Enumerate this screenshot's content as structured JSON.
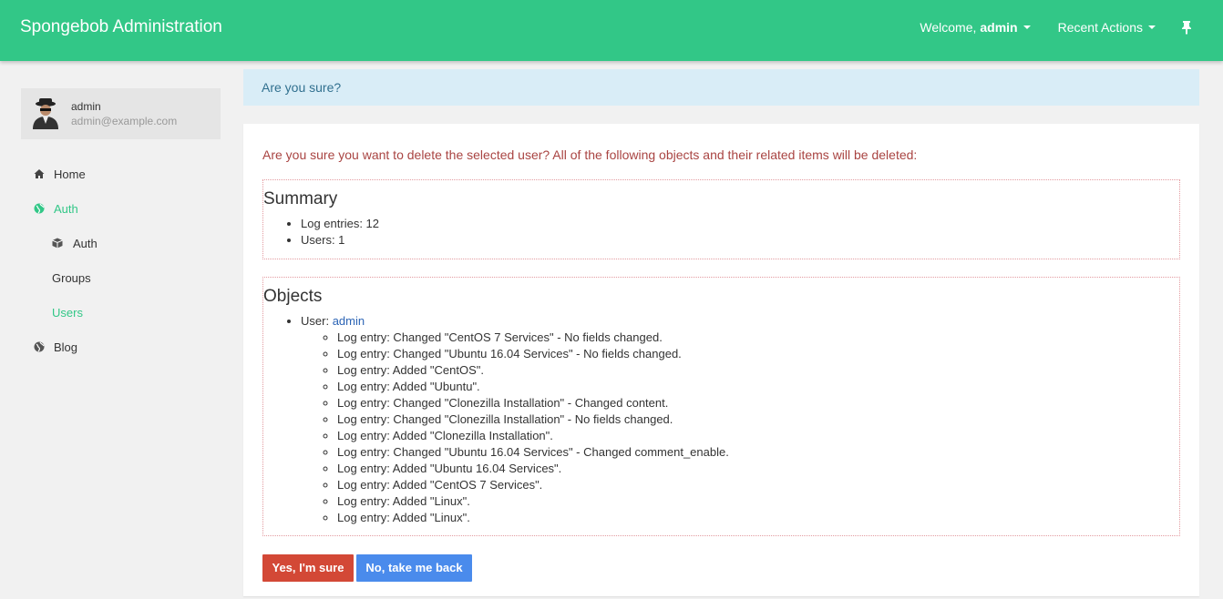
{
  "navbar": {
    "brand": "Spongebob Administration",
    "welcome_prefix": "Welcome,",
    "welcome_user": "admin",
    "recent_actions": "Recent Actions",
    "color": "#32c787"
  },
  "profile": {
    "name": "admin",
    "email": "admin@example.com"
  },
  "sidebar": {
    "items": [
      {
        "label": "Home",
        "icon": "home-icon"
      },
      {
        "label": "Auth",
        "icon": "globe-icon"
      },
      {
        "label": "Auth",
        "icon": "cube-icon"
      },
      {
        "label": "Groups"
      },
      {
        "label": "Users"
      },
      {
        "label": "Blog",
        "icon": "globe-icon"
      }
    ]
  },
  "alert": "Are you sure?",
  "question": "Are you sure you want to delete the selected user? All of the following objects and their related items will be deleted:",
  "summary": {
    "title": "Summary",
    "items": [
      "Log entries: 12",
      "Users: 1"
    ]
  },
  "objects": {
    "title": "Objects",
    "user_prefix": "User:",
    "user_link": "admin",
    "entries": [
      "Log entry: Changed \"CentOS 7 Services\" - No fields changed.",
      "Log entry: Changed \"Ubuntu 16.04 Services\" - No fields changed.",
      "Log entry: Added \"CentOS\".",
      "Log entry: Added \"Ubuntu\".",
      "Log entry: Changed \"Clonezilla Installation\" - Changed content.",
      "Log entry: Changed \"Clonezilla Installation\" - No fields changed.",
      "Log entry: Added \"Clonezilla Installation\".",
      "Log entry: Changed \"Ubuntu 16.04 Services\" - Changed comment_enable.",
      "Log entry: Added \"Ubuntu 16.04 Services\".",
      "Log entry: Added \"CentOS 7 Services\".",
      "Log entry: Added \"Linux\".",
      "Log entry: Added \"Linux\"."
    ]
  },
  "buttons": {
    "yes": "Yes, I'm sure",
    "no": "No, take me back"
  }
}
